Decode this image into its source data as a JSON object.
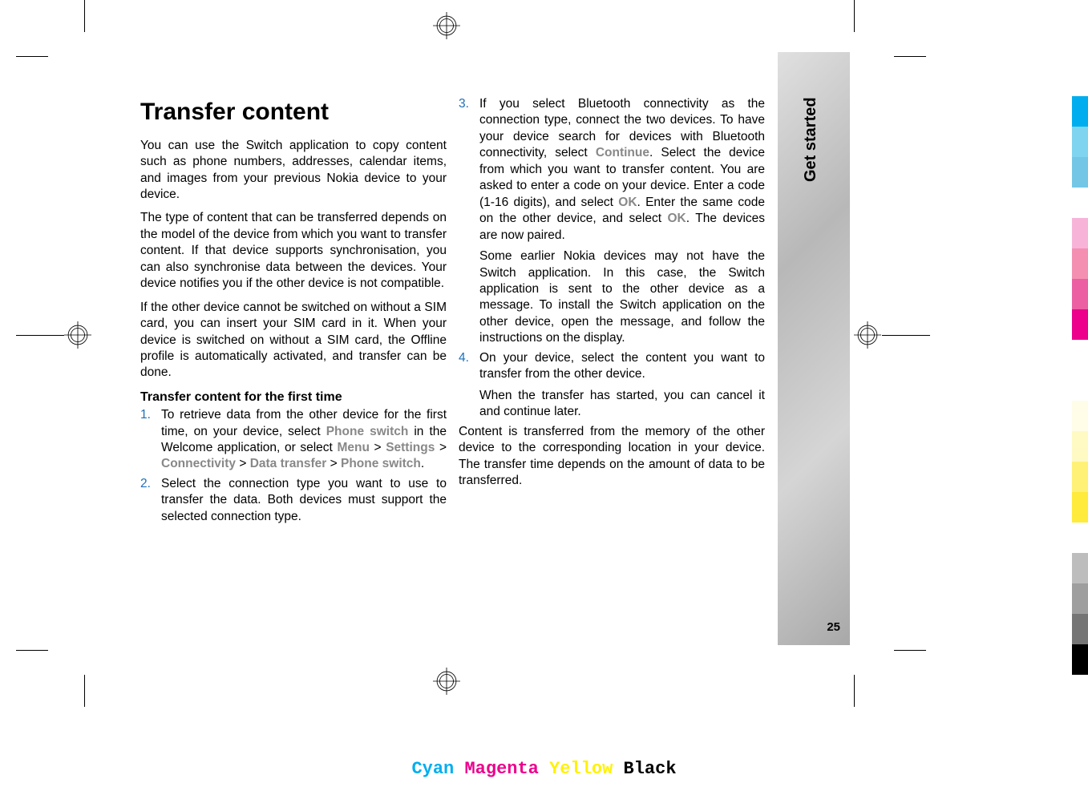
{
  "heading": "Transfer content",
  "section_label": "Get started",
  "page_number": "25",
  "col1": {
    "p1": "You can use the Switch application to copy content such as phone numbers, addresses, calendar items, and images from your previous Nokia device to your device.",
    "p2": "The type of content that can be transferred depends on the model of the device from which you want to transfer content. If that device supports synchronisation, you can also synchronise data between the devices. Your device notifies you if the other device is not compatible.",
    "p3": "If the other device cannot be switched on without a SIM card, you can insert your SIM card in it. When your device is switched on without a SIM card, the Offline profile is automatically activated, and transfer can be done.",
    "h2": "Transfer content for the first time",
    "li1_a": "To retrieve data from the other device for the first time, on your device, select ",
    "li1_phone_switch": "Phone switch",
    "li1_b": " in the Welcome application, or select ",
    "li1_menu": "Menu",
    "li1_gt1": "  >  ",
    "li1_settings": "Settings",
    "li1_gt2": "  >  ",
    "li1_connectivity": "Connectivity",
    "li1_gt3": "  >  ",
    "li1_data_transfer": "Data transfer",
    "li1_gt4": "  >  ",
    "li1_phone_switch2": "Phone switch",
    "li1_c": ".",
    "li2": "Select the connection type you want to use to transfer the data. Both devices must support the selected connection type."
  },
  "col2": {
    "li3_a": "If you select Bluetooth connectivity as the connection type, connect the two devices. To have your device search for devices with Bluetooth connectivity, select ",
    "li3_continue": "Continue",
    "li3_b": ". Select the device from which you want to transfer content. You are asked to enter a code on your device. Enter a code (1-16 digits), and select ",
    "li3_ok1": "OK",
    "li3_c": ". Enter the same code on the other device, and select ",
    "li3_ok2": "OK",
    "li3_d": ". The devices are now paired.",
    "li3_sub": "Some earlier Nokia devices may not have the Switch application. In this case, the Switch application is sent to the other device as a message. To install the Switch application on the other device, open the message, and follow the instructions on the display.",
    "li4_a": "On your device, select the content you want to transfer from the other device.",
    "li4_sub": "When the transfer has started, you can cancel it and continue later.",
    "p4": "Content is transferred from the memory of the other device to the corresponding location in your device. The transfer time depends on the amount of data to be transferred."
  },
  "footer": {
    "cyan": "Cyan",
    "magenta": "Magenta",
    "yellow": "Yellow",
    "black": "Black"
  },
  "color_bars": [
    "#00aeef",
    "#7fd4f0",
    "#73c6e6",
    "#ffffff",
    "#f8b3d9",
    "#f48fb1",
    "#ec5fa3",
    "#ec008c",
    "#ffffff",
    "#ffffff",
    "#fffde7",
    "#fff9c4",
    "#fff176",
    "#ffeb3b",
    "#ffffff",
    "#bdbdbd",
    "#9e9e9e",
    "#757575",
    "#000000"
  ]
}
